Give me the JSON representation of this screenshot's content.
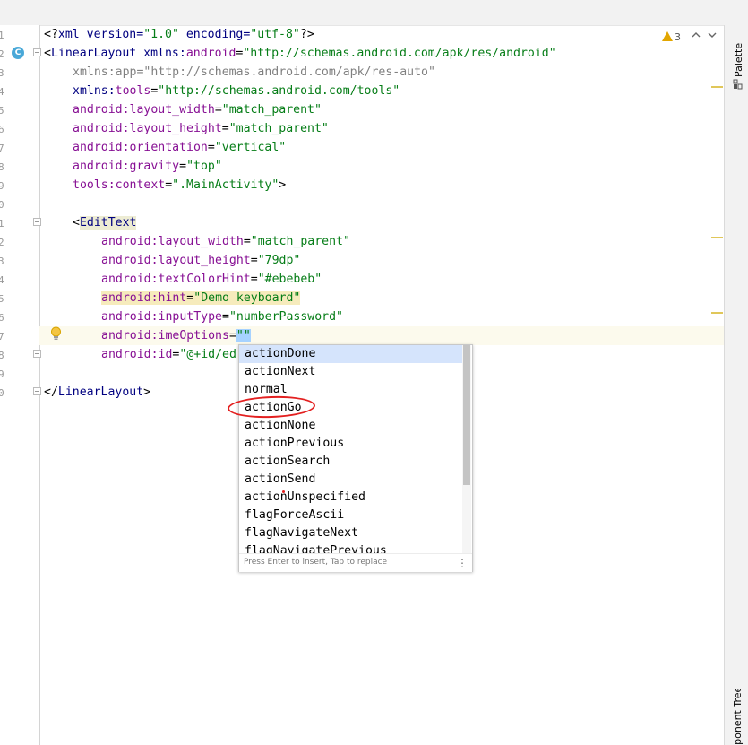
{
  "gutter": {
    "line_numbers": [
      "1",
      "2",
      "3",
      "4",
      "5",
      "6",
      "7",
      "8",
      "9",
      "0",
      "1",
      "2",
      "3",
      "4",
      "5",
      "6",
      "7",
      "8",
      "9",
      "0"
    ],
    "badge": "C"
  },
  "status": {
    "warning_count": "3",
    "chevron_up": "^",
    "chevron_down": "v"
  },
  "code": {
    "l1": {
      "a": "<?",
      "b": "xml",
      "c": " version=",
      "d": "\"1.0\"",
      "e": " encoding=",
      "f": "\"utf-8\"",
      "g": "?>"
    },
    "l2": {
      "a": "<",
      "b": "LinearLayout ",
      "c": "xmlns:",
      "d": "android",
      "e": "=",
      "f": "\"http://schemas.android.com/apk/res/android\""
    },
    "l3": {
      "a": "xmlns:app=\"http://schemas.android.com/apk/res-auto\""
    },
    "l4": {
      "a": "xmlns:",
      "b": "tools",
      "c": "=",
      "d": "\"http://schemas.android.com/tools\""
    },
    "l5": {
      "a": "android:",
      "b": "layout_width",
      "c": "=",
      "d": "\"match_parent\""
    },
    "l6": {
      "a": "android:",
      "b": "layout_height",
      "c": "=",
      "d": "\"match_parent\""
    },
    "l7": {
      "a": "android:",
      "b": "orientation",
      "c": "=",
      "d": "\"vertical\""
    },
    "l8": {
      "a": "android:",
      "b": "gravity",
      "c": "=",
      "d": "\"top\""
    },
    "l9": {
      "a": "tools:",
      "b": "context",
      "c": "=",
      "d": "\".MainActivity\"",
      "e": ">"
    },
    "l11": {
      "a": "<",
      "b": "EditText"
    },
    "l12": {
      "a": "android:",
      "b": "layout_width",
      "c": "=",
      "d": "\"match_parent\""
    },
    "l13": {
      "a": "android:",
      "b": "layout_height",
      "c": "=",
      "d": "\"79dp\""
    },
    "l14": {
      "a": "android:",
      "b": "textColorHint",
      "c": "=",
      "d": "\"#ebebeb\""
    },
    "l15": {
      "a": "android:",
      "b": "hint",
      "c": "=",
      "d": "\"Demo keyboard\""
    },
    "l16": {
      "a": "android:",
      "b": "inputType",
      "c": "=",
      "d": "\"numberPassword\""
    },
    "l17": {
      "a": "android:",
      "b": "imeOptions",
      "c": "=",
      "d": "\"\""
    },
    "l18": {
      "a": "android:",
      "b": "id",
      "c": "=",
      "d": "\"@+id/ed"
    },
    "l20": {
      "a": "</",
      "b": "LinearLayout",
      "c": ">"
    }
  },
  "autocomplete": {
    "items": [
      "actionDone",
      "actionNext",
      "normal",
      "actionGo",
      "actionNone",
      "actionPrevious",
      "actionSearch",
      "actionSend",
      "actionUnspecified",
      "flagForceAscii",
      "flagNavigateNext",
      "flagNavigatePrevious"
    ],
    "footer": "Press Enter to insert, Tab to replace",
    "menu_glyph": "⋮"
  },
  "side_tabs": {
    "palette": "Palette",
    "component_tree": "Component Tree"
  },
  "colors": {
    "annotation": "#e32020",
    "selection": "#d5e4fc",
    "caret_row": "#fcfaed"
  }
}
